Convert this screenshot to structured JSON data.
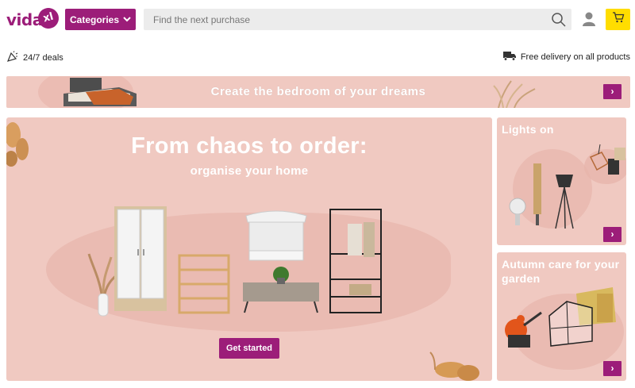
{
  "header": {
    "logo_text": "vida",
    "logo_badge": "xl",
    "categories_label": "Categories",
    "search_placeholder": "Find the next purchase",
    "icons": [
      "chevron-down-icon",
      "search-icon",
      "user-icon",
      "cart-icon"
    ],
    "brand_color": "#9c1d79",
    "cart_color": "#ffdd00"
  },
  "info": {
    "deals_label": "24/7 deals",
    "delivery_label": "Free delivery on all products"
  },
  "bedroom_banner": {
    "title": "Create the bedroom of your dreams",
    "arrow": "›"
  },
  "hero": {
    "title": "From chaos to order:",
    "subtitle": "organise your home",
    "button_label": "Get started",
    "background_color": "#f0c9c1"
  },
  "cards": [
    {
      "title": "Lights on",
      "arrow": "›"
    },
    {
      "title": "Autumn care for your garden",
      "arrow": "›"
    }
  ]
}
